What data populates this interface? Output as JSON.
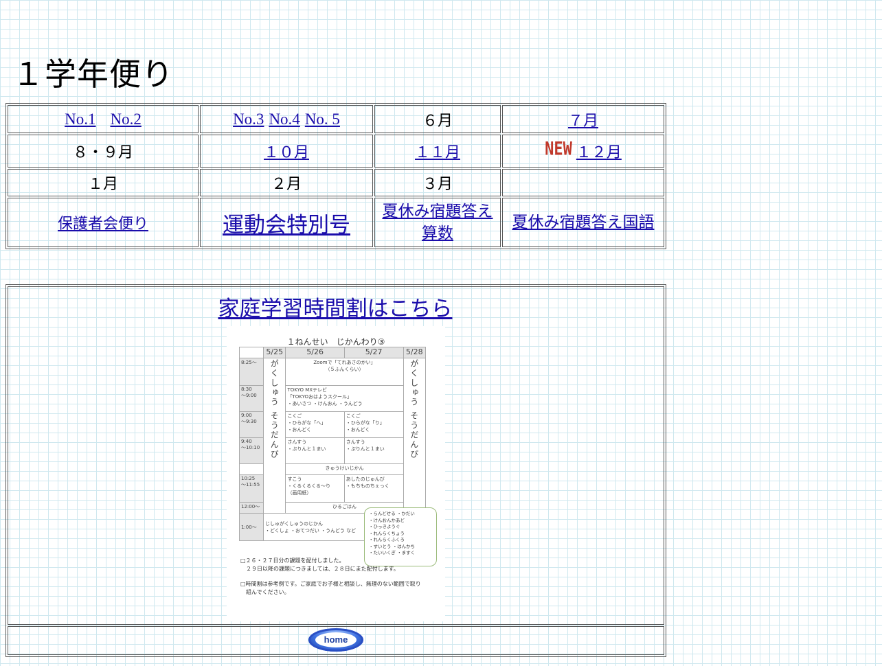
{
  "page": {
    "title": "１学年便り"
  },
  "grid": {
    "row1": {
      "no1": "No.1",
      "no2": "No.2",
      "no3": "No.3",
      "no4": "No.4",
      "no5": "No. 5",
      "jun": "６月",
      "jul": "７月"
    },
    "row2": {
      "aug_sep": "８・９月",
      "oct": "１０月",
      "nov": "１１月",
      "new_badge": "NEW",
      "dec": "１２月"
    },
    "row3": {
      "jan": "１月",
      "feb": "２月",
      "mar": "３月"
    },
    "row4": {
      "guardian": "保護者会便り",
      "sports_day": "運動会特別号",
      "summer_math_line1": "夏休み宿題答え",
      "summer_math_line2": "算数",
      "summer_japanese": "夏休み宿題答え国語"
    }
  },
  "home_study": {
    "link": "家庭学習時間割はこちら",
    "schedule": {
      "title": "１ねんせい　じかんわり③",
      "dates": [
        "5/25",
        "5/26",
        "5/27",
        "5/28"
      ],
      "times": [
        "8:25〜",
        "8:30\n〜9:00",
        "9:00\n〜9:30",
        "9:40\n〜10:10",
        "",
        "10:25\n〜11:55",
        "12:00〜",
        "1:00〜"
      ],
      "vertical_text": "がくしゅう そうだんび",
      "r1": "Zoomで「てれあさのかい」\n（５ふんくらい）",
      "r2": "TOKYO MXテレビ\n「TOKYOおはようスクール」\n・あいさつ ・けんおん ・うんどう",
      "r3a": "こくご\n・ひらがな「へ」\n・おんどく",
      "r3b": "こくご\n・ひらがな「り」\n・おんどく",
      "r4a": "さんすう\n・ぷりんと１まい",
      "r4b": "さんすう\n・ぷりんと１まい",
      "break": "きゅうけいじかん",
      "r6a": "すこう\n・くるくるくる〜り\n（画用紙）",
      "r6b": "あしたのじゅんび\n・もちものちぇっく",
      "lunch": "ひるごはん",
      "r8": "じしゅがくしゅうのじかん\n・どくしょ ・おてつだい ・うんどう など",
      "bubble": "・らんどせる ・かだい\n・けんおんかあど\n・ひっきようぐ\n・れんらくちょう\n・れんらくふくろ\n・すいとう ・はんかち\n・たいいくぎ ・ますく",
      "note1": "□２６・２７日分の課題を配付しました。\n　２９日以降の課題につきましては、２８日にまた配付します。",
      "note2": "□時間割は参考例です。ご家庭でお子様と相談し、無理のない範囲で取り\n　組んでください。"
    }
  },
  "footer": {
    "home_label": "home"
  }
}
